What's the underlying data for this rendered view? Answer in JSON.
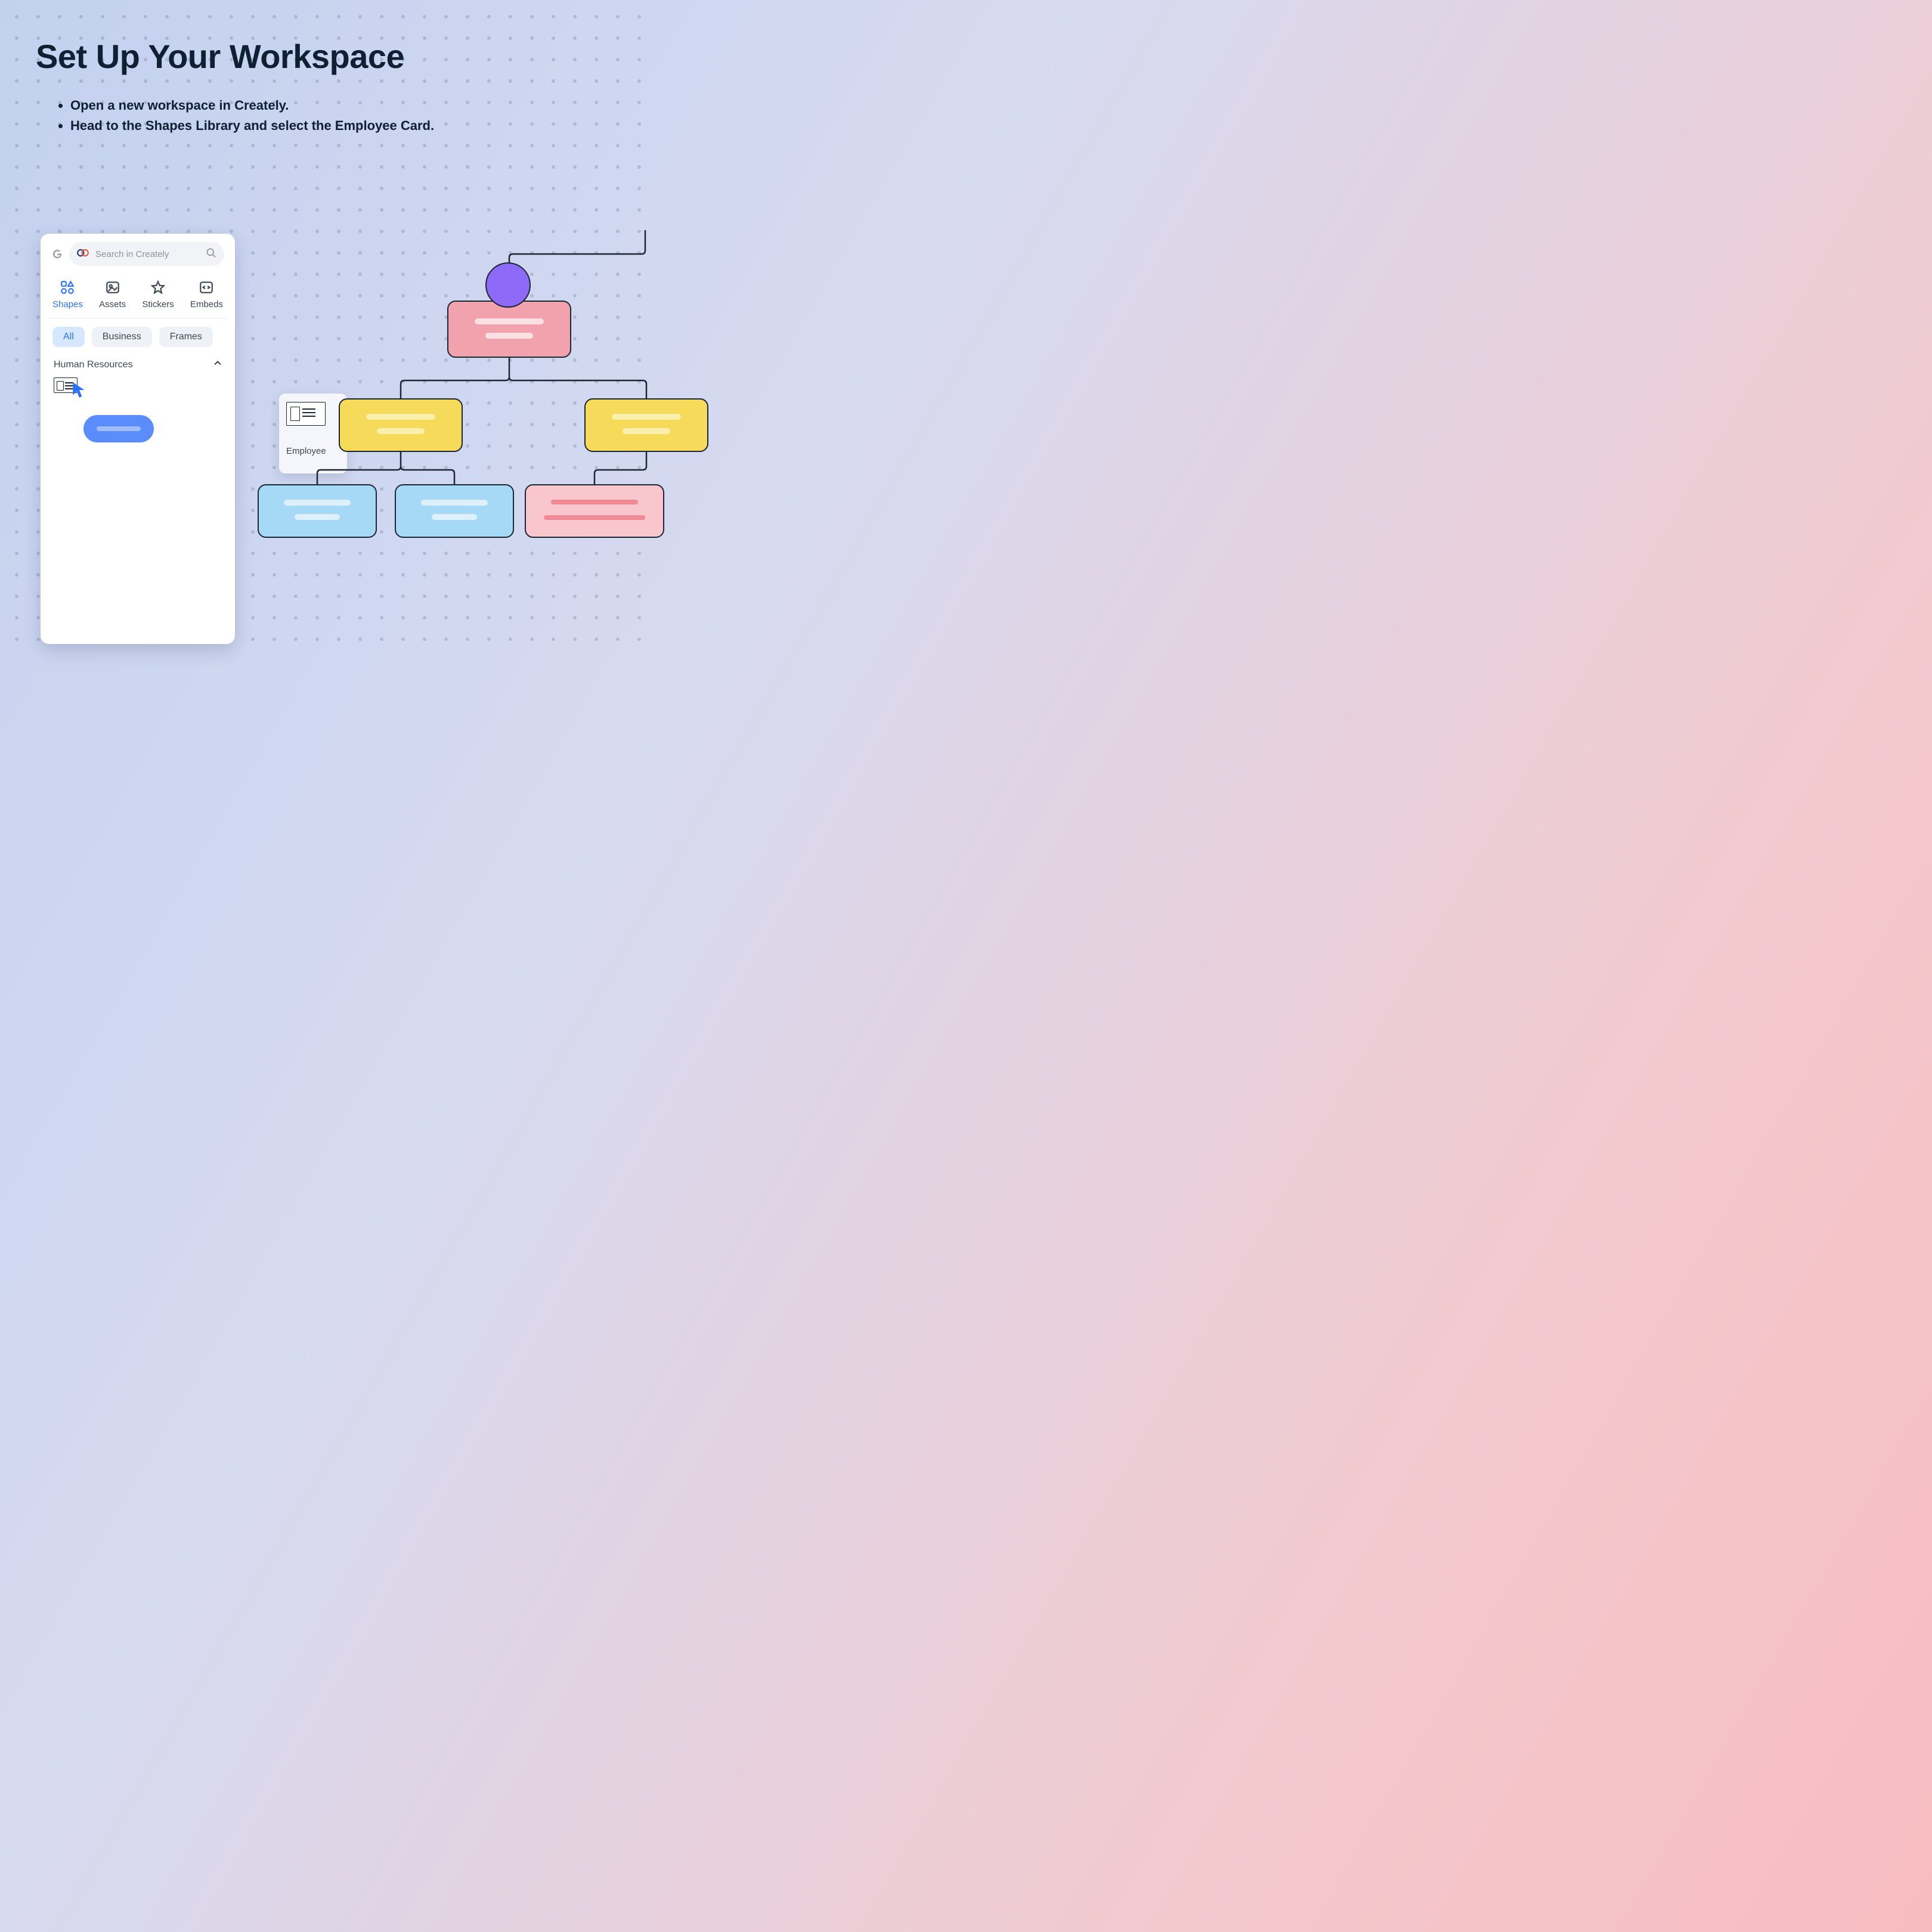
{
  "header": {
    "title": "Set Up Your Workspace",
    "bullets": [
      "Open a new workspace in Creately.",
      "Head to the Shapes Library and select the Employee Card."
    ]
  },
  "panel": {
    "search_placeholder": "Search in Creately",
    "tabs": [
      {
        "id": "shapes",
        "label": "Shapes",
        "active": true
      },
      {
        "id": "assets",
        "label": "Assets",
        "active": false
      },
      {
        "id": "stickers",
        "label": "Stickers",
        "active": false
      },
      {
        "id": "embeds",
        "label": "Embeds",
        "active": false
      }
    ],
    "chips": [
      {
        "label": "All",
        "active": true
      },
      {
        "label": "Business",
        "active": false
      },
      {
        "label": "Frames",
        "active": false
      }
    ],
    "section_title": "Human Resources"
  },
  "drag_preview": {
    "label": "Employee"
  },
  "colors": {
    "accent": "#2a73ff",
    "nodeStroke": "#1c2735",
    "avatar": "#8d6af8",
    "root": "#f2a2ac",
    "mid": "#f6da59",
    "leafBlue": "#a5d9f5",
    "leafPink": "#f8c6cc"
  }
}
